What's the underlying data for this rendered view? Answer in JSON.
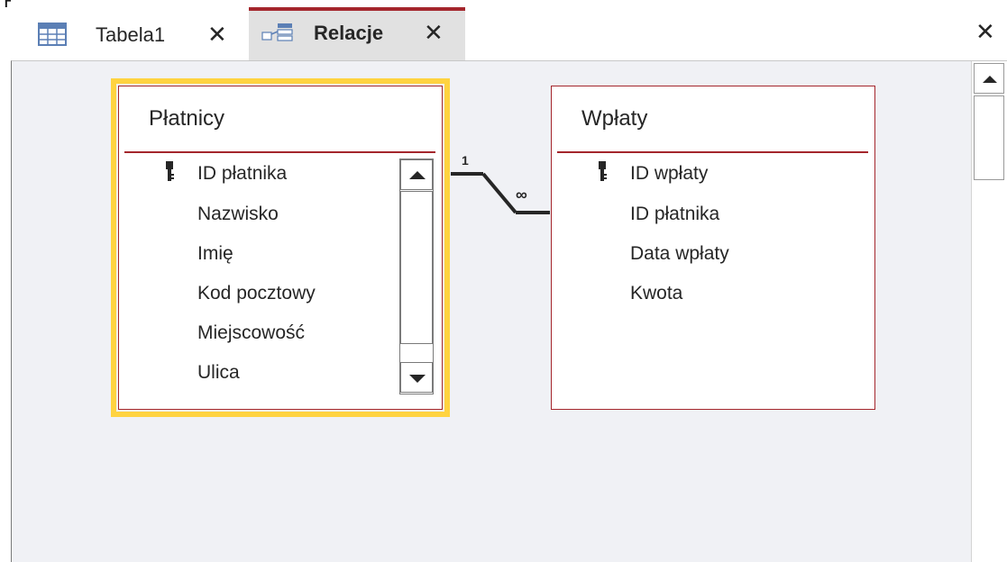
{
  "top_cut_text": "R  j",
  "tabs": [
    {
      "label": "Tabela1",
      "icon": "table-icon",
      "close": "✕"
    },
    {
      "label": "Relacje",
      "icon": "relationships-icon",
      "close": "✕"
    }
  ],
  "document_close": "✕",
  "tables": [
    {
      "title": "Płatnicy",
      "fields": [
        "ID płatnika",
        "Nazwisko",
        "Imię",
        "Kod pocztowy",
        "Miejscowość",
        "Ulica"
      ],
      "key_field": "ID płatnika",
      "selected": true
    },
    {
      "title": "Wpłaty",
      "fields": [
        "ID wpłaty",
        "ID płatnika",
        "Data wpłaty",
        "Kwota"
      ],
      "key_field": "ID wpłaty",
      "selected": false
    }
  ],
  "relationship": {
    "one_side_label": "1",
    "many_side_label": "∞"
  },
  "colors": {
    "accent": "#a4262c",
    "selection": "#ffd340",
    "workspace": "#f0f1f5",
    "active_tab": "#e1e1e1"
  }
}
